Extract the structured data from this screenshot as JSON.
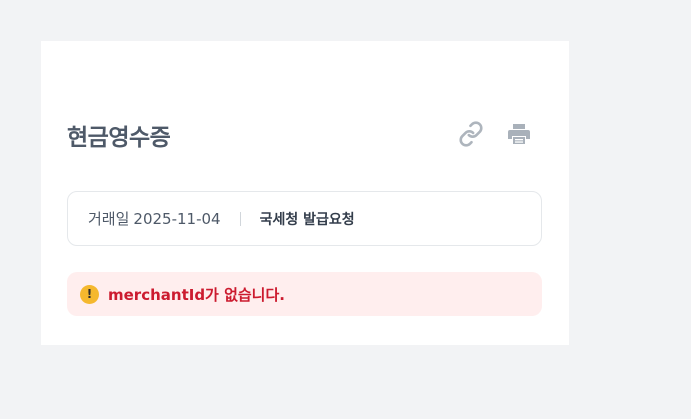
{
  "receipt": {
    "title": "현금영수증",
    "date_label": "거래일",
    "date_value": "2025-11-04",
    "status": "국세청 발급요청",
    "error_message": "merchantId가 없습니다."
  },
  "icons": {
    "link": "link-icon",
    "print": "print-icon",
    "warning": "warning-icon"
  },
  "colors": {
    "background": "#f2f3f5",
    "card": "#ffffff",
    "error_bg": "#ffeeee",
    "error_text": "#cc1b2f",
    "warning": "#f5b82e"
  }
}
